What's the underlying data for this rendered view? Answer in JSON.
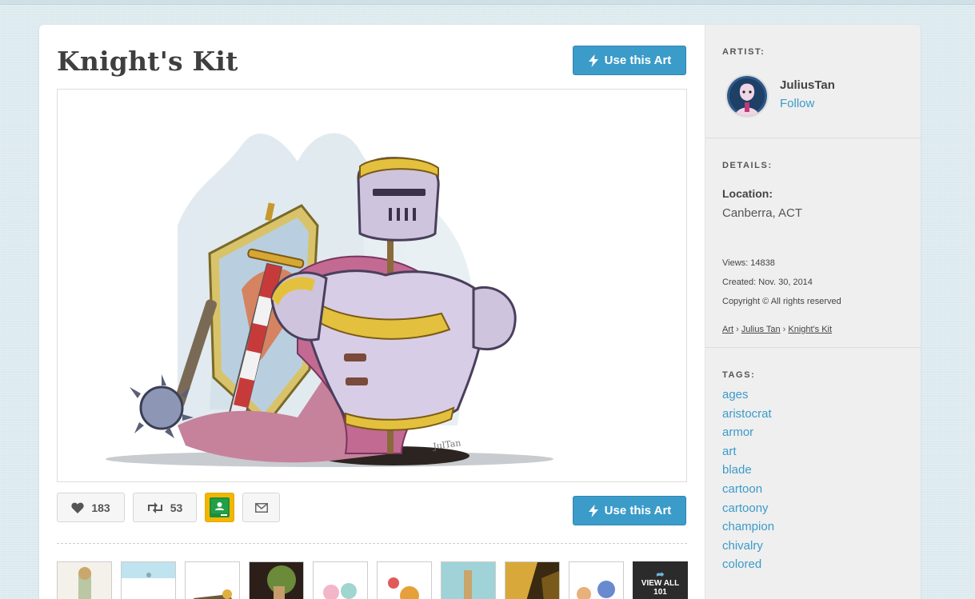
{
  "art": {
    "title": "Knight's Kit",
    "use_label": "Use this Art",
    "likes": "183",
    "shares": "53",
    "view_all": "VIEW ALL",
    "view_all_count": "101"
  },
  "sidebar": {
    "artist_label": "ARTIST:",
    "artist_name": "JuliusTan",
    "follow_label": "Follow",
    "details_label": "DETAILS:",
    "location_label": "Location:",
    "location_value": "Canberra, ACT",
    "views": "Views: 14838",
    "created": "Created: Nov. 30, 2014",
    "copyright": "Copyright © All rights reserved",
    "breadcrumb": [
      "Art",
      "Julius Tan",
      "Knight's Kit"
    ],
    "breadcrumb_sep": "›",
    "tags_label": "TAGS:",
    "tags": [
      "ages",
      "aristocrat",
      "armor",
      "art",
      "blade",
      "cartoon",
      "cartoony",
      "champion",
      "chivalry",
      "colored"
    ]
  },
  "colors": {
    "accent": "#3b9bc9",
    "classroom_yellow": "#f3b600",
    "classroom_green": "#1e8e3e"
  },
  "icons": [
    "bolt-icon",
    "heart-icon",
    "share-icon",
    "google-classroom-icon",
    "mail-icon",
    "share-arrow-icon"
  ]
}
